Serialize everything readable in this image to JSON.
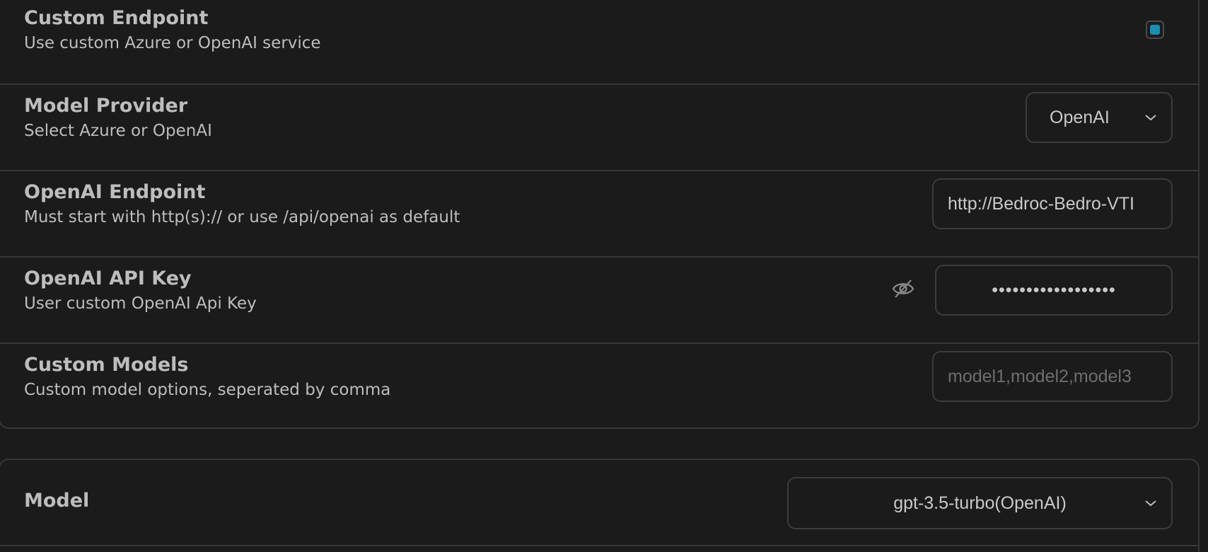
{
  "custom_endpoint": {
    "title": "Custom Endpoint",
    "subtitle": "Use custom Azure or OpenAI service",
    "checked": true,
    "accent_color": "#1a8fb0"
  },
  "model_provider": {
    "title": "Model Provider",
    "subtitle": "Select Azure or OpenAI",
    "selected": "OpenAI"
  },
  "openai_endpoint": {
    "title": "OpenAI Endpoint",
    "subtitle": "Must start with http(s):// or use /api/openai as default",
    "value": "http://Bedroc-Bedro-VTI"
  },
  "openai_api_key": {
    "title": "OpenAI API Key",
    "subtitle": "User custom OpenAI Api Key",
    "masked_value": "••••••••••••••••••",
    "visibility_icon": "eye-off-icon"
  },
  "custom_models": {
    "title": "Custom Models",
    "subtitle": "Custom model options, seperated by comma",
    "placeholder": "model1,model2,model3"
  },
  "model": {
    "title": "Model",
    "selected": "gpt-3.5-turbo(OpenAI)"
  }
}
